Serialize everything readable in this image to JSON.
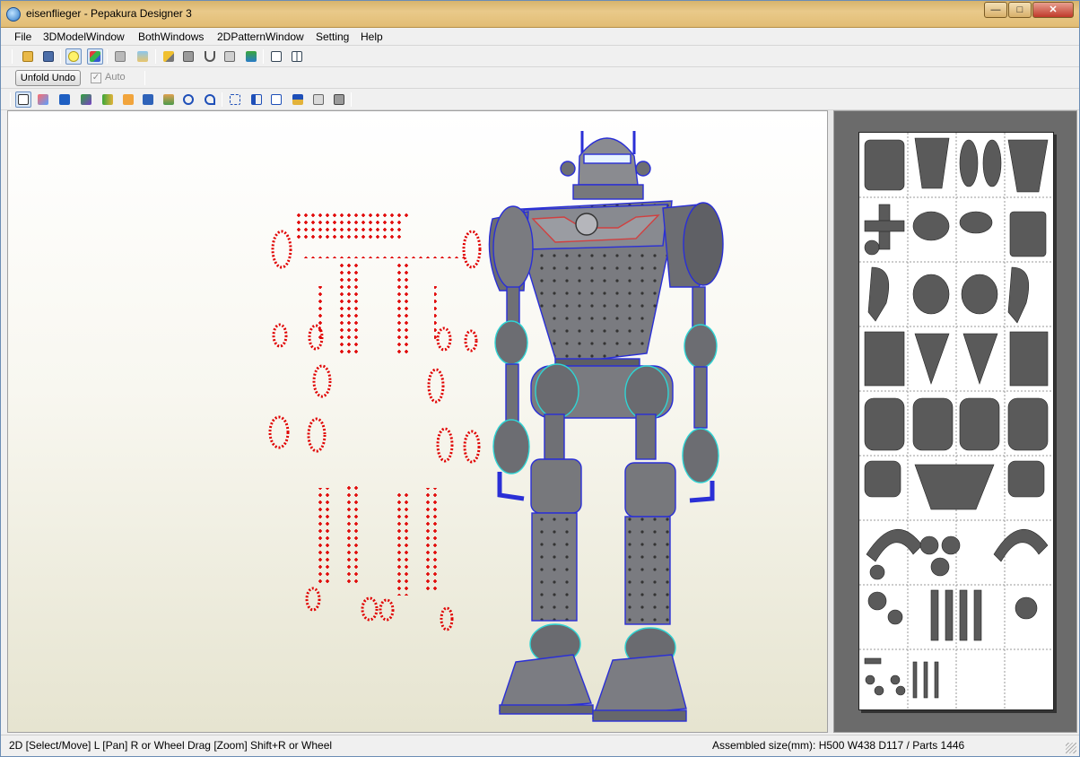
{
  "window": {
    "title": "eisenflieger - Pepakura Designer 3"
  },
  "window_controls": {
    "minimize": "—",
    "maximize": "□",
    "close": "✕"
  },
  "menu": {
    "file": "File",
    "model3d": "3DModelWindow",
    "both": "BothWindows",
    "pattern2d": "2DPatternWindow",
    "setting": "Setting",
    "help": "Help"
  },
  "toolbar2": {
    "unfold_undo": "Unfold Undo",
    "auto_label": "Auto",
    "auto_checked": "✓"
  },
  "toolbar_icons": {
    "row1": [
      "open-folder-icon",
      "save-icon",
      "lightbulb-icon",
      "colored-cube-icon",
      "shaded-cube-icon",
      "textured-cube-icon",
      "pencil-icon",
      "box-icon",
      "anchor-icon",
      "flap-icon",
      "grid-icon",
      "single-window-icon",
      "dual-window-icon"
    ],
    "row3": [
      "select-arrow-icon",
      "select-edge-icon",
      "display-icon",
      "paint-icon",
      "join-icon",
      "text-icon",
      "image-icon",
      "unfold-icon",
      "rotate-icon",
      "undo-icon",
      "frame-icon",
      "layout-icon",
      "page-number-icon",
      "arrange-icon",
      "print-preview-icon",
      "print-icon"
    ]
  },
  "status": {
    "left": "2D [Select/Move] L [Pan] R or Wheel Drag [Zoom] Shift+R or Wheel",
    "right": "Assembled size(mm): H500 W438 D117 / Parts 1446"
  },
  "colors": {
    "titlebar": "#e2bd74",
    "model_edge": "#2a2fd6",
    "model_fill": "#77787c",
    "fold_marks": "#e00000",
    "accent_cyan": "#2fd4d4",
    "pattern_bg": "#6b6b6b"
  }
}
